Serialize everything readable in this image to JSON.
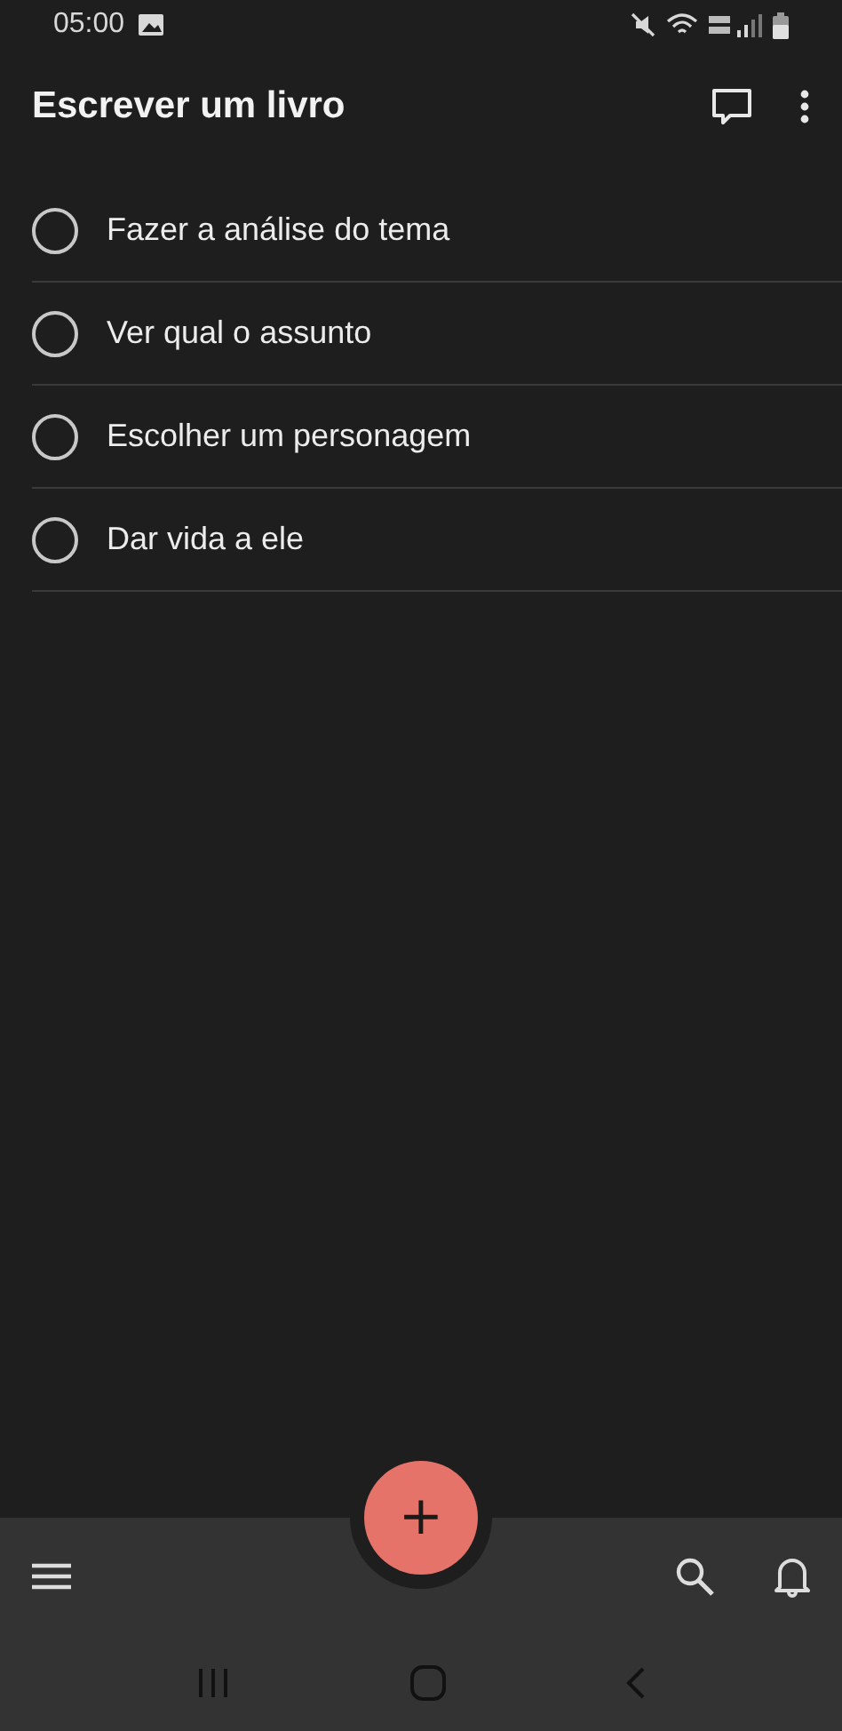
{
  "status_bar": {
    "time": "05:00"
  },
  "header": {
    "title": "Escrever um livro"
  },
  "tasks": [
    {
      "text": "Fazer a análise do tema",
      "checked": false
    },
    {
      "text": "Ver qual o assunto",
      "checked": false
    },
    {
      "text": "Escolher um personagem",
      "checked": false
    },
    {
      "text": "Dar vida a ele",
      "checked": false
    }
  ],
  "fab": {
    "label": "+"
  }
}
